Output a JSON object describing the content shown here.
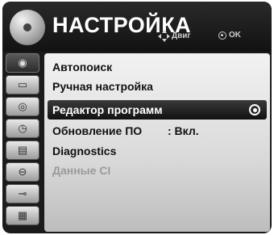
{
  "header": {
    "title": "НАСТРОЙКА",
    "hint_move": "Двиг",
    "hint_ok": "OK"
  },
  "sidebar": {
    "items": [
      {
        "icon": "settings-disc-icon",
        "active": true
      },
      {
        "icon": "picture-icon"
      },
      {
        "icon": "audio-icon"
      },
      {
        "icon": "time-icon"
      },
      {
        "icon": "option-icon"
      },
      {
        "icon": "lock-icon"
      },
      {
        "icon": "input-icon"
      },
      {
        "icon": "movie-icon"
      }
    ]
  },
  "menu": {
    "items": [
      {
        "label": "Автопоиск"
      },
      {
        "label": "Ручная настройка"
      },
      {
        "label": "Редактор программ",
        "selected": true
      },
      {
        "label": "Обновление ПО",
        "value": ": Вкл."
      },
      {
        "label": "Diagnostics"
      },
      {
        "label": "Данные CI",
        "disabled": true
      }
    ]
  }
}
